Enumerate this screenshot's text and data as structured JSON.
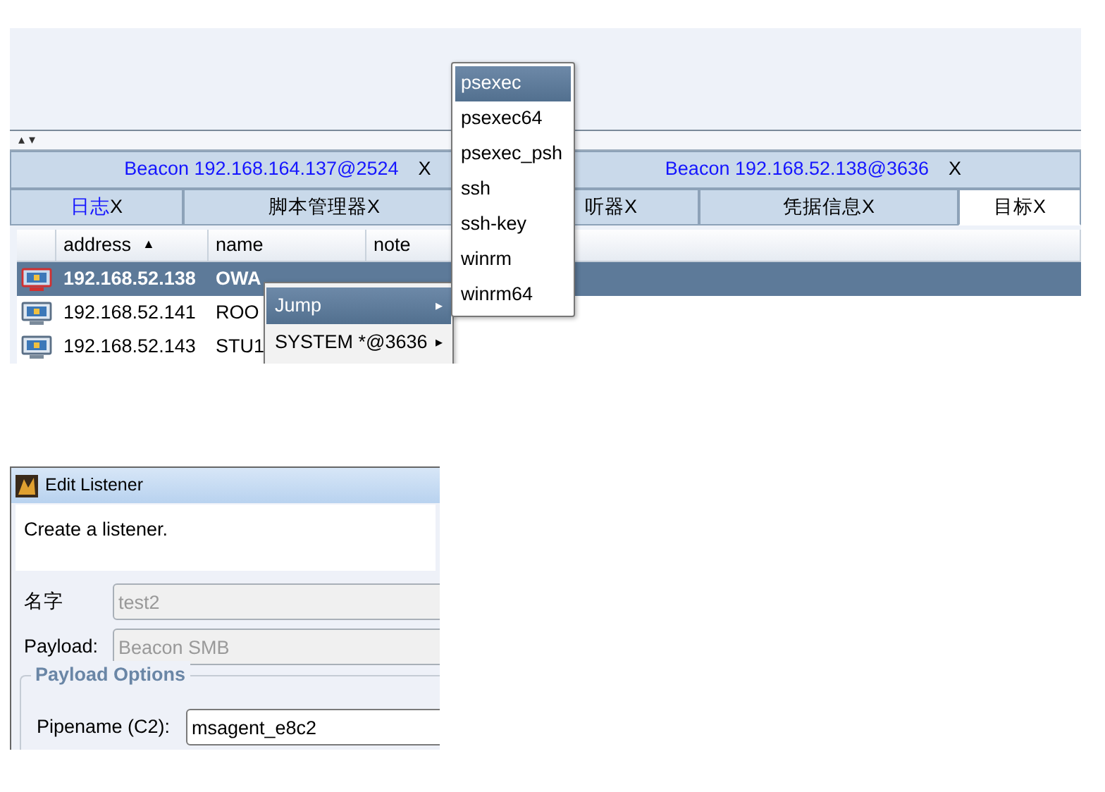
{
  "splitter": {
    "arrows": "▴ ▾"
  },
  "session_tabs": [
    {
      "label": "Beacon 192.168.164.137@2524",
      "close": "X",
      "highlighted": true
    },
    {
      "label": "Beacon 192.168.52.138@3636",
      "close": "X",
      "highlighted": true
    }
  ],
  "tabs": [
    {
      "label": "日志",
      "close": "X",
      "highlighted": true,
      "selected": false
    },
    {
      "label": "脚本管理器",
      "close": "X",
      "highlighted": false,
      "selected": false
    },
    {
      "label": "听器",
      "close": "X",
      "highlighted": false,
      "selected": false
    },
    {
      "label": "凭据信息",
      "close": "X",
      "highlighted": false,
      "selected": false
    },
    {
      "label": "目标",
      "close": "X",
      "highlighted": false,
      "selected": true
    }
  ],
  "table": {
    "columns": [
      {
        "label": "address",
        "sort": "▲"
      },
      {
        "label": "name"
      },
      {
        "label": "note"
      }
    ],
    "rows": [
      {
        "kind": "session",
        "selected": true,
        "address": "192.168.52.138",
        "name": "OWA"
      },
      {
        "kind": "host",
        "selected": false,
        "address": "192.168.52.141",
        "name": "ROO"
      },
      {
        "kind": "host",
        "selected": false,
        "address": "192.168.52.143",
        "name": "STU1"
      }
    ]
  },
  "context_menu": [
    {
      "label": "Jump",
      "arrow": "▸",
      "selected": true
    },
    {
      "label": "SYSTEM *@3636",
      "arrow": "▸",
      "selected": false
    }
  ],
  "submenu": [
    {
      "label": "psexec",
      "selected": true
    },
    {
      "label": "psexec64",
      "selected": false
    },
    {
      "label": "psexec_psh",
      "selected": false
    },
    {
      "label": "ssh",
      "selected": false
    },
    {
      "label": "ssh-key",
      "selected": false
    },
    {
      "label": "winrm",
      "selected": false
    },
    {
      "label": "winrm64",
      "selected": false
    }
  ],
  "dialog": {
    "title": "Edit Listener",
    "description": "Create a listener.",
    "fields": [
      {
        "label": "名字",
        "value": "test2",
        "disabled": true
      },
      {
        "label": "Payload:",
        "value": "Beacon SMB",
        "disabled": true
      }
    ],
    "group": {
      "legend": "Payload Options",
      "fields": [
        {
          "label": "Pipename (C2):",
          "value": "msagent_e8c2",
          "disabled": false
        }
      ]
    }
  }
}
